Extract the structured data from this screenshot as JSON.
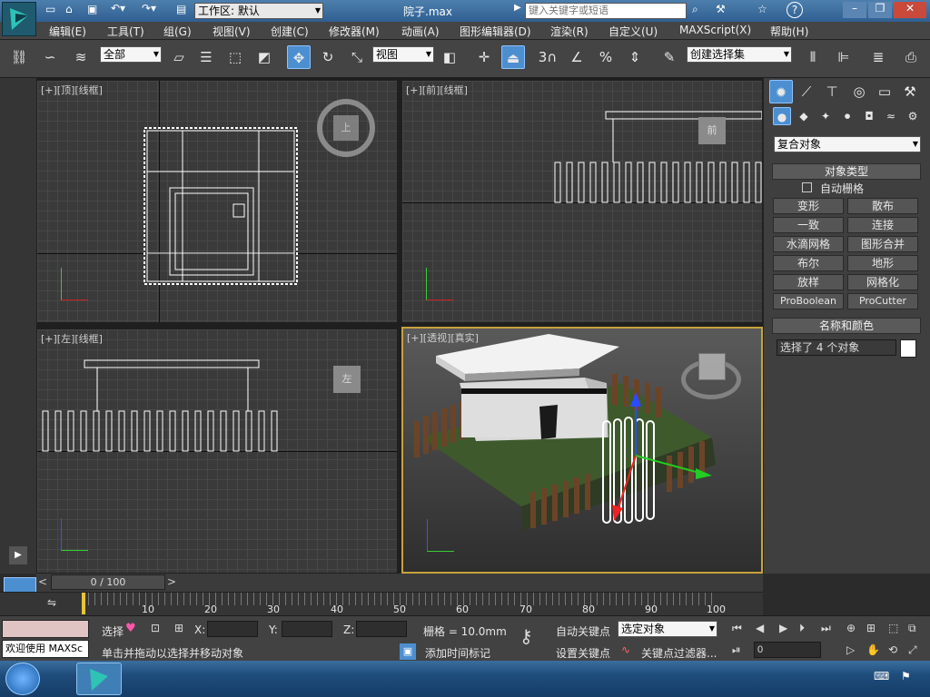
{
  "titlebar": {
    "workspace": "工作区: 默认",
    "file": "院子.max",
    "search_placeholder": "键入关键字或短语"
  },
  "menu": [
    "编辑(E)",
    "工具(T)",
    "组(G)",
    "视图(V)",
    "创建(C)",
    "修改器(M)",
    "动画(A)",
    "图形编辑器(D)",
    "渲染(R)",
    "自定义(U)",
    "MAXScript(X)",
    "帮助(H)"
  ],
  "toolbar": {
    "filter": "全部",
    "ref_coord": "视图",
    "selection_set": "创建选择集",
    "snap_angle": "3"
  },
  "viewports": [
    {
      "label": "[+][顶][线框]",
      "cube": "上"
    },
    {
      "label": "[+][前][线框]",
      "cube": "前"
    },
    {
      "label": "[+][左][线框]",
      "cube": "左"
    },
    {
      "label": "[+][透视][真实]",
      "cube": ""
    }
  ],
  "cmdpanel": {
    "category": "复合对象",
    "rollout_type": "对象类型",
    "autogrid": "自动栅格",
    "buttons": [
      "变形",
      "散布",
      "一致",
      "连接",
      "水滴网格",
      "图形合并",
      "布尔",
      "地形",
      "放样",
      "网格化",
      "ProBoolean",
      "ProCutter"
    ],
    "rollout_name": "名称和颜色",
    "selection_text": "选择了 4 个对象"
  },
  "timeline": {
    "frame": "0 / 100",
    "ticks": [
      "10",
      "20",
      "30",
      "40",
      "50",
      "60",
      "70",
      "80",
      "90",
      "100"
    ]
  },
  "status": {
    "maxscript": "欢迎使用 MAXSc",
    "select_label": "选择",
    "x": "X:",
    "y": "Y:",
    "z": "Z:",
    "grid": "栅格 = 10.0mm",
    "prompt": "单击并拖动以选择并移动对象",
    "add_marker": "添加时间标记",
    "auto_key": "自动关键点",
    "set_key": "设置关键点",
    "key_mode": "选定对象",
    "key_filter": "关键点过滤器...",
    "frame_value": "0"
  },
  "colors": {
    "accent": "#4c8fd1",
    "viewport_active": "#c8a23a"
  }
}
